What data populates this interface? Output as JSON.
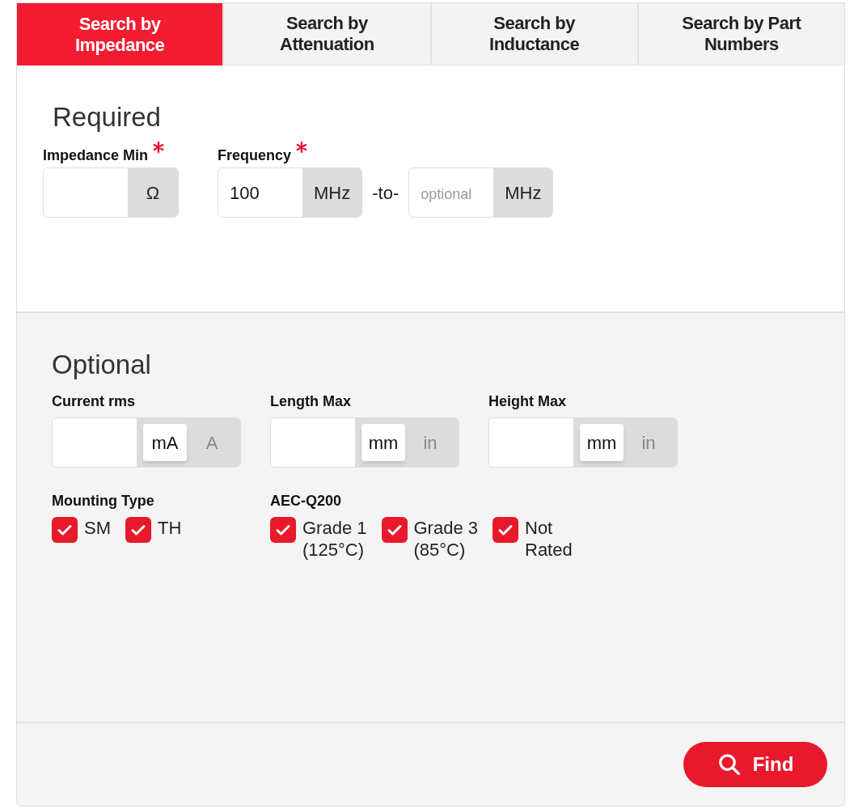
{
  "tabs": [
    {
      "label": "Search by\nImpedance",
      "selected": true
    },
    {
      "label": "Search by\nAttenuation",
      "selected": false
    },
    {
      "label": "Search by\nInductance",
      "selected": false
    },
    {
      "label": "Search by Part\nNumbers",
      "selected": false
    }
  ],
  "required": {
    "title": "Required",
    "fields": [
      {
        "label": "Impedance Min",
        "required": true,
        "parts": [
          {
            "kind": "input",
            "unit": "Ω"
          }
        ]
      },
      {
        "label": "Frequency",
        "required": true,
        "parts": [
          {
            "kind": "input",
            "value": "100",
            "unit": "MHz"
          },
          {
            "kind": "separator",
            "text": "-to-"
          },
          {
            "kind": "input",
            "placeholder": "optional",
            "unit": "MHz"
          }
        ]
      }
    ]
  },
  "optional": {
    "title": "Optional",
    "fields": [
      {
        "label": "Current rms",
        "units": [
          {
            "label": "mA",
            "selected": true
          },
          {
            "label": "A",
            "selected": false
          }
        ]
      },
      {
        "label": "Length Max",
        "units": [
          {
            "label": "mm",
            "selected": true
          },
          {
            "label": "in",
            "selected": false
          }
        ]
      },
      {
        "label": "Height Max",
        "units": [
          {
            "label": "mm",
            "selected": true
          },
          {
            "label": "in",
            "selected": false
          }
        ]
      }
    ],
    "checkbox_groups": [
      {
        "label": "Mounting Type",
        "options": [
          {
            "label": "SM",
            "checked": true
          },
          {
            "label": "TH",
            "checked": true
          }
        ]
      },
      {
        "label": "AEC-Q200",
        "options": [
          {
            "label": "Grade 1\n(125°C)",
            "checked": true
          },
          {
            "label": "Grade 3\n(85°C)",
            "checked": true
          },
          {
            "label": "Not\nRated",
            "checked": true
          }
        ]
      }
    ]
  },
  "find_button": "Find"
}
